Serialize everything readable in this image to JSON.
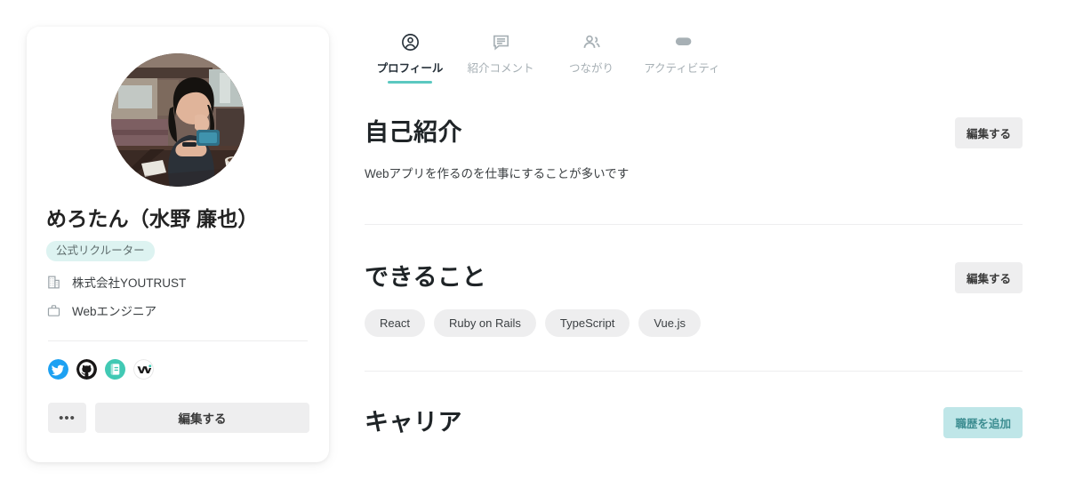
{
  "profile": {
    "avatar_name": "user-avatar-photo",
    "name": "めろたん（水野 廉也）",
    "badge": "公式リクルーター",
    "company": {
      "icon": "building-icon",
      "text": "株式会社YOUTRUST"
    },
    "role": {
      "icon": "briefcase-icon",
      "text": "Webエンジニア"
    },
    "social": [
      {
        "icon": "twitter-icon",
        "label": "Twitter",
        "color": "#1da1f2"
      },
      {
        "icon": "github-icon",
        "label": "GitHub",
        "color": "#191717"
      },
      {
        "icon": "note-icon",
        "label": "note",
        "color": "#41c9b4"
      },
      {
        "icon": "wantedly-icon",
        "label": "Wantedly",
        "color": "#ffffff"
      }
    ],
    "more_label": "•••",
    "edit_label": "編集する"
  },
  "tabs": [
    {
      "icon": "person-circle-icon",
      "label": "プロフィール",
      "active": true
    },
    {
      "icon": "comment-icon",
      "label": "紹介コメント",
      "active": false
    },
    {
      "icon": "people-icon",
      "label": "つながり",
      "active": false
    },
    {
      "icon": "tag-icon",
      "label": "アクティビティ",
      "active": false
    }
  ],
  "sections": {
    "about": {
      "title": "自己紹介",
      "button": "編集する",
      "body": "Webアプリを作るのを仕事にすることが多いです"
    },
    "skills": {
      "title": "できること",
      "button": "編集する",
      "tags": [
        "React",
        "Ruby on Rails",
        "TypeScript",
        "Vue.js"
      ]
    },
    "career": {
      "title": "キャリア",
      "button": "職歴を追加"
    }
  },
  "colors": {
    "accent_teal": "#5bc8c0",
    "badge_bg": "#ddf3f1",
    "button_bg": "#eeeeef",
    "primary_button_bg": "#bfe6e8",
    "primary_button_text": "#3c8d91"
  }
}
